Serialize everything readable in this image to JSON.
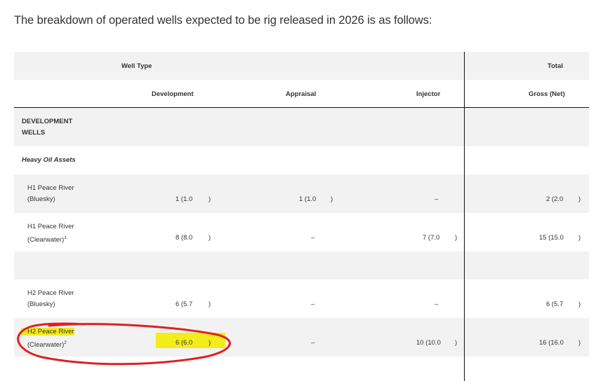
{
  "intro": "The breakdown of operated wells expected to be rig released in 2026 is as follows:",
  "header": {
    "well_type": "Well Type",
    "total": "Total",
    "development": "Development",
    "appraisal": "Appraisal",
    "injector": "Injector",
    "gross_net": "Gross (Net)"
  },
  "section": {
    "title_line1": "DEVELOPMENT",
    "title_line2": "WELLS",
    "subsection": "Heavy Oil Assets"
  },
  "rows": [
    {
      "name1": "H1 Peace River",
      "name2": "(Bluesky)",
      "sup": "",
      "dev": "1 (1.0",
      "dev_close": ")",
      "app": "1 (1.0",
      "app_close": ")",
      "inj": "–",
      "inj_close": "",
      "total": "2 (2.0",
      "total_close": ")"
    },
    {
      "name1": "H1 Peace River",
      "name2": "(Clearwater)",
      "sup": "1",
      "dev": "8 (8.0",
      "dev_close": ")",
      "app": "–",
      "app_close": "",
      "inj": "7 (7.0",
      "inj_close": ")",
      "total": "15 (15.0",
      "total_close": ")"
    },
    {
      "name1": "H2 Peace River",
      "name2": "(Bluesky)",
      "sup": "",
      "dev": "6 (5.7",
      "dev_close": ")",
      "app": "–",
      "app_close": "",
      "inj": "–",
      "inj_close": "",
      "total": "6 (5.7",
      "total_close": ")"
    },
    {
      "name1": "H2 Peace River",
      "name2": "(Clearwater)",
      "sup": "2",
      "dev": "6 (6.0",
      "dev_close": ")",
      "app": "–",
      "app_close": "",
      "inj": "10 (10.0",
      "inj_close": ")",
      "total": "16 (16.0",
      "total_close": ")"
    }
  ],
  "colors": {
    "highlight": "#f3ec1b",
    "annotation": "#e02020",
    "row_grey": "#f2f2f2"
  }
}
